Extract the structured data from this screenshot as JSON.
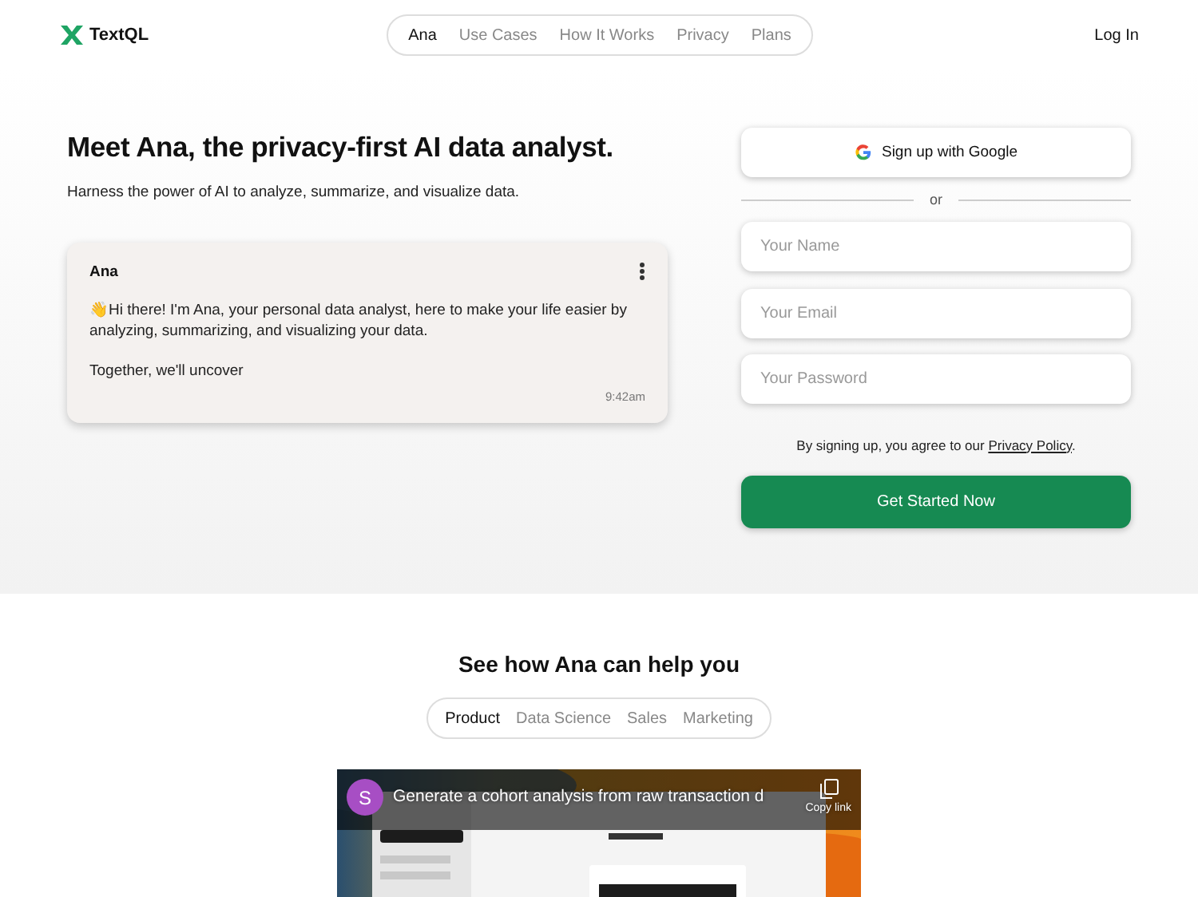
{
  "header": {
    "logo": "TextQL",
    "nav": [
      {
        "label": "Ana",
        "selected": true
      },
      {
        "label": "Use Cases",
        "selected": false
      },
      {
        "label": "How It Works",
        "selected": false
      },
      {
        "label": "Privacy",
        "selected": false
      },
      {
        "label": "Plans",
        "selected": false
      }
    ],
    "login": "Log In"
  },
  "hero": {
    "title": "Meet Ana, the privacy-first AI data analyst.",
    "subtitle": "Harness the power of AI to analyze, summarize, and visualize data.",
    "chat": {
      "sender": "Ana",
      "emoji": "👋",
      "paragraphs": [
        "Hi there! I'm Ana, your personal data analyst, here to make your life easier by analyzing, summarizing, and visualizing your data.",
        "Together, we'll uncover"
      ],
      "time": "9:42am"
    }
  },
  "signup": {
    "google_button": "Sign up with Google",
    "divider": "or",
    "fields": [
      {
        "placeholder": "Your Name"
      },
      {
        "placeholder": "Your Email"
      },
      {
        "placeholder": "Your Password"
      }
    ],
    "terms": "By signing up, you agree to our",
    "terms_link": "Privacy Policy",
    "terms_end": ".",
    "submit": "Get Started Now"
  },
  "use_cases": {
    "title": "See how Ana can help you",
    "tabs": [
      {
        "label": "Product",
        "selected": true
      },
      {
        "label": "Data Science",
        "selected": false
      },
      {
        "label": "Sales",
        "selected": false
      },
      {
        "label": "Marketing",
        "selected": false
      }
    ],
    "video": {
      "kind": "picture",
      "channel_avatar": "S",
      "title": "Generate a cohort analysis from raw transaction d",
      "copy_label": "Copy link"
    }
  }
}
